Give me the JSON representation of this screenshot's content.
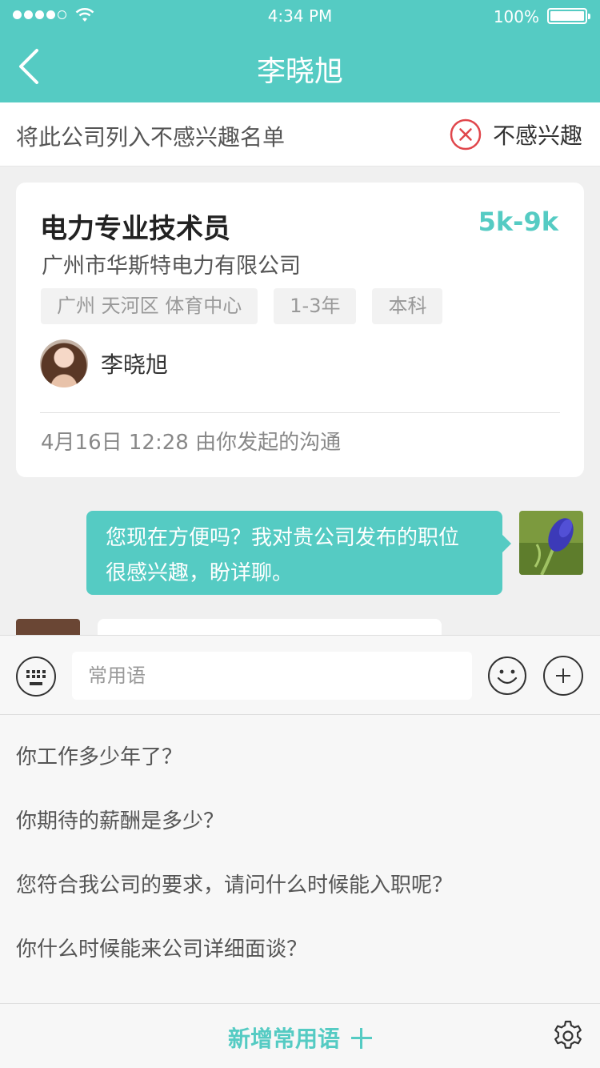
{
  "status_bar": {
    "time": "4:34 PM",
    "battery": "100%"
  },
  "nav": {
    "title": "李晓旭"
  },
  "notice": {
    "text": "将此公司列入不感兴趣名单",
    "button_label": "不感兴趣"
  },
  "job": {
    "title": "电力专业技术员",
    "salary": "5k-9k",
    "company": "广州市华斯特电力有限公司",
    "tags": [
      "广州 天河区 体育中心",
      "1-3年",
      "本科"
    ],
    "recruiter": "李晓旭",
    "footer": "4月16日 12:28 由你发起的沟通"
  },
  "messages": {
    "sent_line1": "您现在方便吗？我对贵公司发布的职位",
    "sent_line2": "很感兴趣，盼详聊。"
  },
  "input": {
    "placeholder": "常用语"
  },
  "phrases": [
    "你工作多少年了？",
    "你期待的薪酬是多少？",
    "您符合我公司的要求，请问什么时候能入职呢？",
    "你什么时候能来公司详细面谈？"
  ],
  "bottom": {
    "add_label": "新增常用语"
  },
  "colors": {
    "accent": "#55cbc3",
    "danger": "#e0464b"
  }
}
